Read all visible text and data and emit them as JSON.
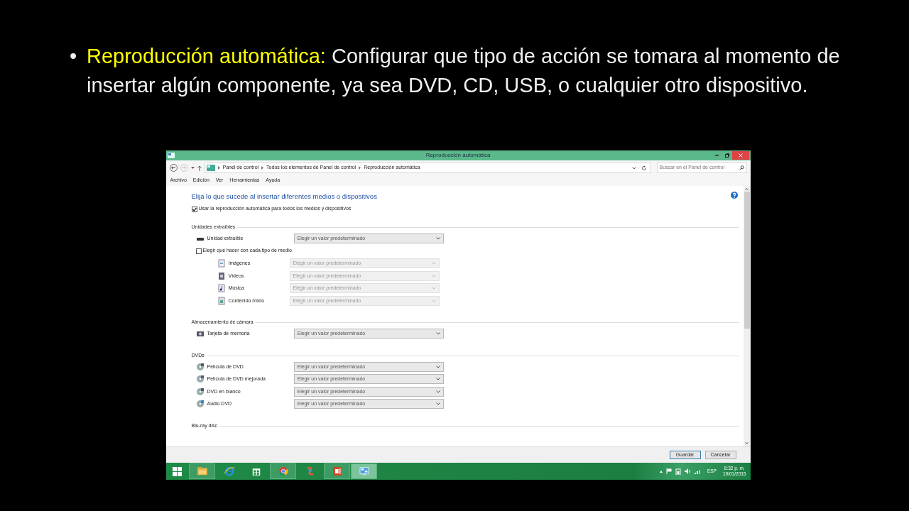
{
  "slide": {
    "bullet": "•",
    "heading": "Reproducción automática:",
    "text": " Configurar que tipo de acción se tomara al momento de insertar algún componente, ya sea DVD, CD, USB, o cualquier otro dispositivo."
  },
  "window": {
    "title": "Reproducción automática",
    "breadcrumb": [
      "Panel de control",
      "Todos los elementos de Panel de control",
      "Reproducción automática"
    ],
    "search": {
      "placeholder": "Buscar en el Panel de control"
    },
    "menu": [
      "Archivo",
      "Edición",
      "Ver",
      "Herramientas",
      "Ayuda"
    ],
    "heading": "Elija lo que sucede al insertar diferentes medios o dispositivos",
    "autoplay": {
      "label": "Usar la reproducción automática para todos los medios y dispositivos",
      "checked": true
    },
    "sections": [
      {
        "title": "Unidades extraíbles",
        "rows": [
          {
            "kind": "select",
            "label": "Unidad extraíble",
            "value": "Elegir un valor predeterminado",
            "disabled": false
          },
          {
            "kind": "checkbox",
            "label": "Elegir qué hacer con cada tipo de medio",
            "checked": false,
            "children": [
              {
                "kind": "select",
                "label": "Imágenes",
                "value": "Elegir un valor predeterminado",
                "disabled": true
              },
              {
                "kind": "select",
                "label": "Vídeos",
                "value": "Elegir un valor predeterminado",
                "disabled": true
              },
              {
                "kind": "select",
                "label": "Música",
                "value": "Elegir un valor predeterminado",
                "disabled": true
              },
              {
                "kind": "select",
                "label": "Contenido mixto",
                "value": "Elegir un valor predeterminado",
                "disabled": true
              }
            ]
          }
        ]
      },
      {
        "title": "Almacenamiento de cámara",
        "rows": [
          {
            "kind": "select",
            "label": "Tarjeta de memoria",
            "value": "Elegir un valor predeterminado",
            "disabled": false
          }
        ]
      },
      {
        "title": "DVDs",
        "rows": [
          {
            "kind": "select",
            "label": "Película de DVD",
            "value": "Elegir un valor predeterminado",
            "disabled": false
          },
          {
            "kind": "select",
            "label": "Película de DVD mejorada",
            "value": "Elegir un valor predeterminado",
            "disabled": false
          },
          {
            "kind": "select",
            "label": "DVD en blanco",
            "value": "Elegir un valor predeterminado",
            "disabled": false
          },
          {
            "kind": "select",
            "label": "Audio DVD",
            "value": "Elegir un valor predeterminado",
            "disabled": false
          }
        ]
      },
      {
        "title": "Blu-ray disc"
      }
    ],
    "buttons": [
      "Guardar",
      "Cancelar"
    ]
  },
  "taskbar": {
    "apps": [
      {
        "running": true,
        "selected": false
      },
      {
        "running": false,
        "selected": false
      },
      {
        "running": false,
        "selected": false
      },
      {
        "running": true,
        "selected": false
      },
      {
        "running": false,
        "selected": false
      },
      {
        "running": true,
        "selected": false
      },
      {
        "running": true,
        "selected": true
      }
    ],
    "language": "ESP",
    "time": "8:32 p. m.",
    "date": "19/01/2015"
  }
}
